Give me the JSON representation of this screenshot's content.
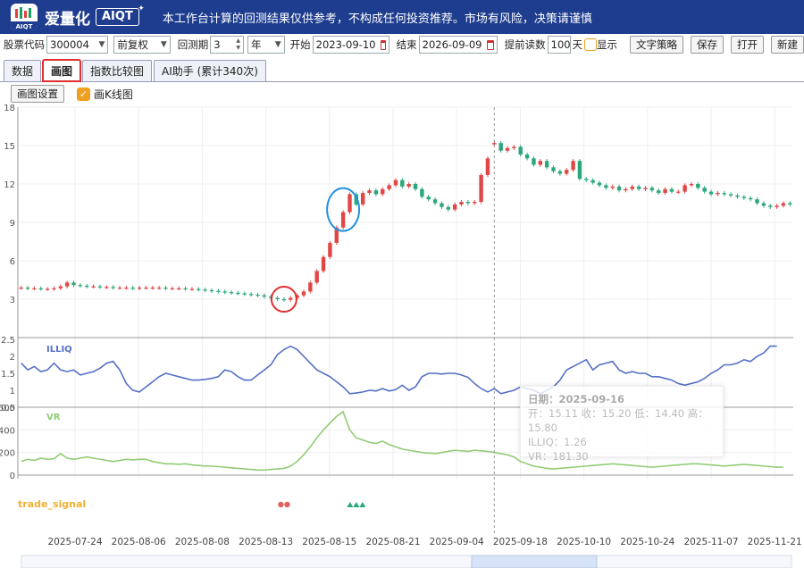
{
  "header": {
    "brand": "爱量化",
    "badge": "AIQT",
    "logo_text": "AIQT",
    "disclaimer": "本工作台计算的回测结果仅供参考，不构成任何投资推荐。市场有风险，决策请谨慎"
  },
  "toolbar": {
    "stock_label": "股票代码",
    "stock_value": "300004",
    "adjust_value": "前复权",
    "period_label": "回测期",
    "period_value": "3",
    "period_unit": "年",
    "start_label": "开始",
    "start_value": "2023-09-10",
    "end_label": "结束",
    "end_value": "2026-09-09",
    "preload_label": "提前读数",
    "preload_value": "100",
    "preload_unit": "天",
    "show_label": "显示",
    "text_strategy": "文字策略",
    "save": "保存",
    "open": "打开",
    "new": "新建"
  },
  "tabs": [
    "数据",
    "画图",
    "指数比较图",
    "AI助手 (累计340次)"
  ],
  "subbar": {
    "settings": "画图设置",
    "kline_label": "画K线图"
  },
  "tooltip": {
    "date": "日期：2025-09-16",
    "ohlc": "开：15.11 收：15.20 低：14.40 高：15.80",
    "illiq": "ILLIQ：1.26",
    "vr": "VR：181.30"
  },
  "chart_data": {
    "type": "candlestick",
    "x_ticks": [
      "2025-07-24",
      "2025-08-06",
      "2025-08-08",
      "2025-08-13",
      "2025-08-15",
      "2025-08-21",
      "2025-09-04",
      "2025-09-18",
      "2025-10-10",
      "2025-10-24",
      "2025-11-07",
      "2025-11-21"
    ],
    "price_ticks": [
      "3",
      "6",
      "9",
      "12",
      "15",
      "18"
    ],
    "price_ylim": [
      0,
      18
    ],
    "price_close": [
      3.9,
      3.85,
      3.85,
      3.8,
      3.8,
      3.85,
      4.0,
      4.3,
      4.1,
      4.05,
      4.0,
      4.0,
      3.95,
      3.95,
      3.9,
      3.9,
      3.9,
      3.85,
      3.9,
      3.9,
      3.9,
      3.9,
      3.85,
      3.85,
      3.85,
      3.8,
      3.8,
      3.75,
      3.7,
      3.65,
      3.6,
      3.55,
      3.5,
      3.45,
      3.4,
      3.35,
      3.3,
      3.2,
      3.1,
      3.0,
      2.95,
      3.1,
      3.3,
      3.6,
      4.3,
      5.2,
      6.3,
      7.4,
      8.6,
      9.8,
      11.2,
      10.4,
      11.3,
      11.5,
      11.2,
      11.6,
      11.9,
      12.3,
      11.8,
      12.0,
      11.6,
      11.0,
      10.8,
      10.5,
      10.2,
      10.0,
      10.4,
      10.6,
      10.5,
      10.6,
      12.7,
      14.0,
      15.2,
      14.6,
      14.8,
      14.9,
      14.3,
      14.0,
      13.5,
      13.8,
      13.3,
      13.0,
      12.8,
      13.1,
      13.8,
      12.4,
      12.3,
      12.1,
      11.9,
      11.7,
      11.8,
      11.5,
      11.6,
      11.8,
      11.6,
      11.7,
      11.5,
      11.3,
      11.6,
      11.4,
      11.4,
      11.9,
      12.0,
      11.7,
      11.4,
      11.2,
      11.3,
      11.2,
      11.1,
      11.0,
      10.9,
      10.8,
      10.5,
      10.3,
      10.2,
      10.3,
      10.5,
      10.4
    ],
    "candle_open_offsets": [
      0,
      0.05,
      0,
      0.05,
      0,
      -0.05,
      -0.15,
      -0.3,
      0.2,
      0.05,
      0.05,
      0,
      0.05,
      0,
      0.05,
      0,
      0,
      0.05,
      -0.05,
      0,
      0,
      0,
      0.05,
      0,
      0,
      0.05,
      0,
      0.05,
      0.05,
      0.05,
      0.05,
      0.05,
      0.05,
      0.05,
      0.05,
      0.05,
      0.05,
      0.1,
      0.1,
      0.1,
      0.05,
      -0.15,
      -0.2,
      -0.3,
      -0.7,
      -0.9,
      -1.1,
      -1.1,
      -1.2,
      -1.2,
      -1.4,
      0.8,
      -0.9,
      -0.2,
      0.3,
      -0.4,
      -0.3,
      -0.4,
      0.5,
      -0.2,
      0.4,
      0.6,
      0.2,
      0.3,
      0.3,
      0.2,
      -0.4,
      -0.2,
      0.1,
      -0.1,
      -2.1,
      -1.3,
      -0.1,
      0.6,
      -0.2,
      -0.1,
      0.6,
      0.3,
      0.5,
      -0.3,
      0.5,
      0.3,
      0.2,
      -0.3,
      -0.7,
      1.4,
      0.1,
      0.2,
      0.2,
      0.2,
      -0.1,
      0.3,
      -0.1,
      -0.2,
      0.2,
      -0.1,
      0.2,
      0.2,
      -0.3,
      0.2,
      0,
      -0.5,
      -0.1,
      0.3,
      0.3,
      0.2,
      -0.1,
      0.1,
      0.1,
      0.1,
      0.1,
      0.1,
      0.3,
      0.2,
      0.1,
      -0.1,
      -0.2,
      0.1
    ],
    "illiq_ticks": [
      "0.5",
      "1",
      "1.5",
      "2",
      "2.5"
    ],
    "illiq_ylim": [
      0.5,
      2.5
    ],
    "illiq_label": "ILLIQ",
    "illiq": [
      1.8,
      1.6,
      1.7,
      1.55,
      1.6,
      1.8,
      1.6,
      1.55,
      1.6,
      1.45,
      1.5,
      1.55,
      1.65,
      1.8,
      1.85,
      1.6,
      1.2,
      1.0,
      0.95,
      1.1,
      1.25,
      1.4,
      1.5,
      1.45,
      1.4,
      1.35,
      1.3,
      1.3,
      1.32,
      1.35,
      1.4,
      1.6,
      1.55,
      1.4,
      1.3,
      1.3,
      1.45,
      1.6,
      1.75,
      2.05,
      2.2,
      2.3,
      2.2,
      2.0,
      1.8,
      1.6,
      1.5,
      1.4,
      1.25,
      1.1,
      0.9,
      0.92,
      0.95,
      1.0,
      0.98,
      1.05,
      0.98,
      1.02,
      1.15,
      1.0,
      1.1,
      1.4,
      1.5,
      1.5,
      1.48,
      1.5,
      1.5,
      1.45,
      1.38,
      1.2,
      1.05,
      0.95,
      1.05,
      0.9,
      0.95,
      1.0,
      1.1,
      1.05,
      1.0,
      0.9,
      1.0,
      1.1,
      1.3,
      1.6,
      1.7,
      1.8,
      1.9,
      1.6,
      1.75,
      1.8,
      1.85,
      1.6,
      1.5,
      1.55,
      1.5,
      1.5,
      1.4,
      1.4,
      1.35,
      1.3,
      1.2,
      1.15,
      1.2,
      1.25,
      1.35,
      1.5,
      1.6,
      1.75,
      1.75,
      1.8,
      1.9,
      1.85,
      2.0,
      2.1,
      2.3,
      2.3
    ],
    "vr_ticks": [
      "0",
      "200",
      "400",
      "600"
    ],
    "vr_ylim": [
      0,
      600
    ],
    "vr_label": "VR",
    "vr": [
      120,
      140,
      130,
      150,
      140,
      145,
      190,
      150,
      140,
      150,
      160,
      150,
      140,
      130,
      120,
      130,
      140,
      135,
      140,
      140,
      120,
      110,
      100,
      100,
      95,
      100,
      90,
      85,
      80,
      80,
      75,
      70,
      65,
      60,
      55,
      50,
      45,
      45,
      50,
      55,
      60,
      80,
      120,
      180,
      250,
      330,
      400,
      460,
      520,
      560,
      400,
      330,
      310,
      290,
      280,
      300,
      270,
      250,
      230,
      220,
      210,
      200,
      195,
      190,
      200,
      210,
      220,
      215,
      210,
      220,
      215,
      210,
      200,
      190,
      180,
      160,
      120,
      100,
      80,
      70,
      60,
      55,
      60,
      65,
      70,
      75,
      80,
      85,
      90,
      95,
      100,
      95,
      90,
      85,
      80,
      75,
      70,
      75,
      80,
      85,
      90,
      95,
      100,
      100,
      95,
      90,
      85,
      80,
      85,
      90,
      95,
      90,
      85,
      80,
      75,
      70,
      70
    ],
    "signal_label": "trade_signal",
    "signals": [
      {
        "index": 40,
        "kind": "circle",
        "count": 2
      },
      {
        "index": 51,
        "kind": "triangle",
        "count": 3
      }
    ],
    "highlight_circles": [
      {
        "index": 40,
        "price": 3.0,
        "color": "#e03030"
      },
      {
        "index": 49,
        "price": 10.0,
        "color": "#2090e0"
      }
    ],
    "crosshair_index": 72
  }
}
